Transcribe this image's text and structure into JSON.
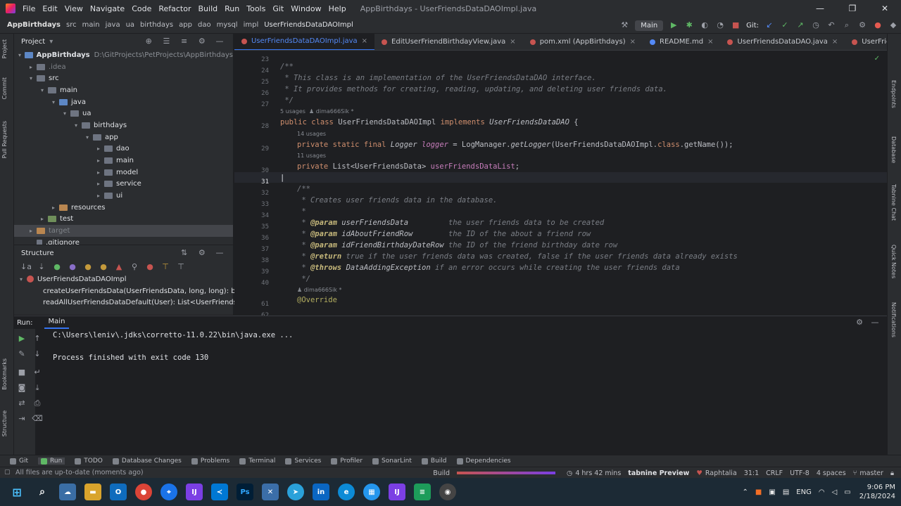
{
  "titlebar": {
    "menu": [
      "File",
      "Edit",
      "View",
      "Navigate",
      "Code",
      "Refactor",
      "Build",
      "Run",
      "Tools",
      "Git",
      "Window",
      "Help"
    ],
    "title": "AppBirthdays - UserFriendsDataDAOImpl.java",
    "minimize": "—",
    "maximize": "❐",
    "close": "✕"
  },
  "navbar": {
    "crumbs": [
      "AppBirthdays",
      "src",
      "main",
      "java",
      "ua",
      "birthdays",
      "app",
      "dao",
      "mysql",
      "impl",
      "UserFriendsDataDAOImpl"
    ],
    "run_config": "Main",
    "git_label": "Git:"
  },
  "project": {
    "header": "Project",
    "tree": [
      {
        "label": "AppBirthdays",
        "path": "D:\\GitProjects\\PetProjects\\AppBirthdays",
        "indent": 0,
        "arrow": "▾",
        "folder": "blue"
      },
      {
        "label": ".idea",
        "indent": 1,
        "arrow": "▸",
        "folder": "grey",
        "dim": true
      },
      {
        "label": "src",
        "indent": 1,
        "arrow": "▾",
        "folder": "grey"
      },
      {
        "label": "main",
        "indent": 2,
        "arrow": "▾",
        "folder": "grey"
      },
      {
        "label": "java",
        "indent": 3,
        "arrow": "▾",
        "folder": "blue"
      },
      {
        "label": "ua",
        "indent": 4,
        "arrow": "▾",
        "folder": "grey"
      },
      {
        "label": "birthdays",
        "indent": 5,
        "arrow": "▾",
        "folder": "grey"
      },
      {
        "label": "app",
        "indent": 6,
        "arrow": "▾",
        "folder": "grey"
      },
      {
        "label": "dao",
        "indent": 7,
        "arrow": "▸",
        "folder": "grey"
      },
      {
        "label": "main",
        "indent": 7,
        "arrow": "▸",
        "folder": "grey"
      },
      {
        "label": "model",
        "indent": 7,
        "arrow": "▸",
        "folder": "grey"
      },
      {
        "label": "service",
        "indent": 7,
        "arrow": "▸",
        "folder": "grey"
      },
      {
        "label": "ui",
        "indent": 7,
        "arrow": "▸",
        "folder": "grey"
      },
      {
        "label": "resources",
        "indent": 3,
        "arrow": "▸",
        "folder": "orange"
      },
      {
        "label": "test",
        "indent": 2,
        "arrow": "▸",
        "folder": "green"
      },
      {
        "label": "target",
        "indent": 1,
        "arrow": "▸",
        "folder": "orange",
        "dim": true,
        "sel": true
      },
      {
        "label": ".gitignore",
        "indent": 1,
        "arrow": "",
        "folder": "none"
      }
    ]
  },
  "structure": {
    "header": "Structure",
    "class_name": "UserFriendsDataDAOImpl",
    "members": [
      "createUserFriendsData(UserFriendsData, long, long): boo",
      "readAllUserFriendsDataDefault(User): List<UserFriendsD"
    ]
  },
  "editor": {
    "tabs": [
      {
        "label": "UserFriendsDataDAOImpl.java",
        "active": true
      },
      {
        "label": "EditUserFriendBirthdayView.java",
        "active": false
      },
      {
        "label": "pom.xml (AppBirthdays)",
        "active": false
      },
      {
        "label": "README.md",
        "active": false
      },
      {
        "label": "UserFriendsDataDAO.java",
        "active": false
      },
      {
        "label": "UserFriendsDataServi",
        "active": false
      }
    ],
    "line_numbers": [
      "23",
      "24",
      "25",
      "26",
      "27",
      "28",
      "29",
      "30",
      "31",
      "32",
      "33",
      "34",
      "35",
      "36",
      "37",
      "38",
      "39",
      "40",
      "61",
      "62"
    ],
    "hints": {
      "class_usages": "5 usages",
      "class_author": "dima666Sik *",
      "logger_usages": "14 usages",
      "list_usages": "11 usages",
      "method_author": "dima666Sik *"
    }
  },
  "run": {
    "label": "Run:",
    "tab": "Main",
    "command": "C:\\Users\\leniv\\.jdks\\corretto-11.0.22\\bin\\java.exe ...",
    "exit": "Process finished with exit code 130"
  },
  "bottom_tools": [
    "Git",
    "Run",
    "TODO",
    "Database Changes",
    "Problems",
    "Terminal",
    "Services",
    "Profiler",
    "SonarLint",
    "Build",
    "Dependencies"
  ],
  "statusbar": {
    "message": "All files are up-to-date (moments ago)",
    "build": "Build",
    "time": "4 hrs 42 mins",
    "tabnine": "tabnine Preview",
    "theme": "Raphtalia",
    "position": "31:1",
    "line_sep": "CRLF",
    "encoding": "UTF-8",
    "indent": "4 spaces",
    "branch": "master"
  },
  "taskbar": {
    "lang": "ENG",
    "time": "9:06 PM",
    "date": "2/18/2024"
  },
  "side_tools": {
    "left": [
      "Project",
      "Commit",
      "Pull Requests",
      "Bookmarks",
      "Structure"
    ],
    "right": [
      "Endpoints",
      "Database",
      "Tabnine Chat",
      "Quick Notes",
      "Notifications"
    ]
  }
}
